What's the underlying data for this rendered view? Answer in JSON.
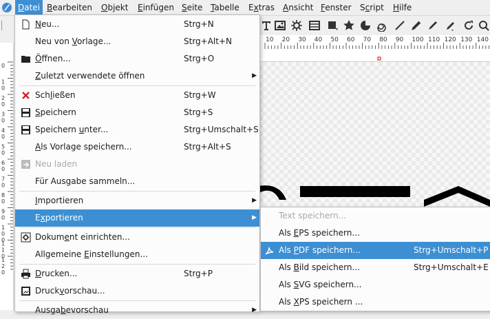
{
  "menubar": {
    "items": [
      {
        "label": "Datei",
        "mnemonic": "D",
        "active": true
      },
      {
        "label": "Bearbeiten",
        "mnemonic": "B"
      },
      {
        "label": "Objekt",
        "mnemonic": "O"
      },
      {
        "label": "Einfügen",
        "mnemonic": "E"
      },
      {
        "label": "Seite",
        "mnemonic": "S"
      },
      {
        "label": "Tabelle",
        "mnemonic": "T"
      },
      {
        "label": "Extras",
        "mnemonic": "x"
      },
      {
        "label": "Ansicht",
        "mnemonic": "A"
      },
      {
        "label": "Fenster",
        "mnemonic": "F"
      },
      {
        "label": "Script",
        "mnemonic": "c"
      },
      {
        "label": "Hilfe",
        "mnemonic": "H"
      }
    ]
  },
  "ruler": {
    "h_ticks": [
      "10",
      "20",
      "30",
      "40",
      "50",
      "60",
      "70",
      "80",
      "90",
      "100",
      "110",
      "120",
      "130",
      "140"
    ],
    "v_ticks": [
      "0",
      "10",
      "20",
      "30",
      "40",
      "50",
      "60",
      "70",
      "80",
      "90",
      "100",
      "110",
      "120"
    ]
  },
  "file_menu": {
    "items": [
      {
        "label": "Neu...",
        "mnemonic": "N",
        "shortcut": "Strg+N",
        "icon": "new-document-icon"
      },
      {
        "label": "Neu von Vorlage...",
        "mnemonic": "V",
        "shortcut": "Strg+Alt+N"
      },
      {
        "label": "Öffnen...",
        "mnemonic": "Ö",
        "shortcut": "Strg+O",
        "icon": "folder-open-icon"
      },
      {
        "label": "Zuletzt verwendete öffnen",
        "mnemonic": "Z",
        "shortcut": "",
        "submenu": true
      },
      {
        "label": "Schließen",
        "mnemonic": "l",
        "shortcut": "Strg+W",
        "icon": "close-icon",
        "sep_before": true
      },
      {
        "label": "Speichern",
        "mnemonic": "S",
        "shortcut": "Strg+S",
        "icon": "save-icon"
      },
      {
        "label": "Speichern unter...",
        "mnemonic": "u",
        "shortcut": "Strg+Umschalt+S",
        "icon": "save-as-icon"
      },
      {
        "label": "Als Vorlage speichern...",
        "mnemonic": "A",
        "shortcut": "Strg+Alt+S"
      },
      {
        "label": "Neu laden",
        "mnemonic": "d",
        "shortcut": "",
        "icon": "reload-icon",
        "disabled": true
      },
      {
        "label": "Für Ausgabe sammeln...",
        "mnemonic": "g",
        "shortcut": ""
      },
      {
        "label": "Importieren",
        "mnemonic": "I",
        "shortcut": "",
        "submenu": true,
        "sep_before": true
      },
      {
        "label": "Exportieren",
        "mnemonic": "x",
        "shortcut": "",
        "submenu": true,
        "highlighted": true
      },
      {
        "label": "Dokument einrichten...",
        "mnemonic": "e",
        "shortcut": "",
        "icon": "document-setup-icon",
        "sep_before": true
      },
      {
        "label": "Allgemeine Einstellungen...",
        "mnemonic": "E",
        "shortcut": ""
      },
      {
        "label": "Drucken...",
        "mnemonic": "D",
        "shortcut": "Strg+P",
        "icon": "printer-icon",
        "sep_before": true
      },
      {
        "label": "Druckvorschau...",
        "mnemonic": "v",
        "shortcut": "",
        "icon": "print-preview-icon"
      },
      {
        "label": "Ausgabevorschau",
        "mnemonic": "b",
        "shortcut": "",
        "submenu": true,
        "sep_before": true
      }
    ]
  },
  "export_menu": {
    "items": [
      {
        "label": "Text speichern...",
        "mnemonic": "T",
        "shortcut": "",
        "disabled": true
      },
      {
        "label": "Als EPS speichern...",
        "mnemonic": "E",
        "shortcut": ""
      },
      {
        "label": "Als PDF speichern...",
        "mnemonic": "P",
        "shortcut": "Strg+Umschalt+P",
        "icon": "pdf-icon",
        "highlighted": true
      },
      {
        "label": "Als Bild speichern...",
        "mnemonic": "B",
        "shortcut": "Strg+Umschalt+E"
      },
      {
        "label": "Als SVG speichern...",
        "mnemonic": "S",
        "shortcut": ""
      },
      {
        "label": "Als XPS speichern ...",
        "mnemonic": "X",
        "shortcut": ""
      }
    ]
  },
  "colors": {
    "accent": "#3d8fd4",
    "danger": "#d42020",
    "canvas_text": "#000000"
  }
}
